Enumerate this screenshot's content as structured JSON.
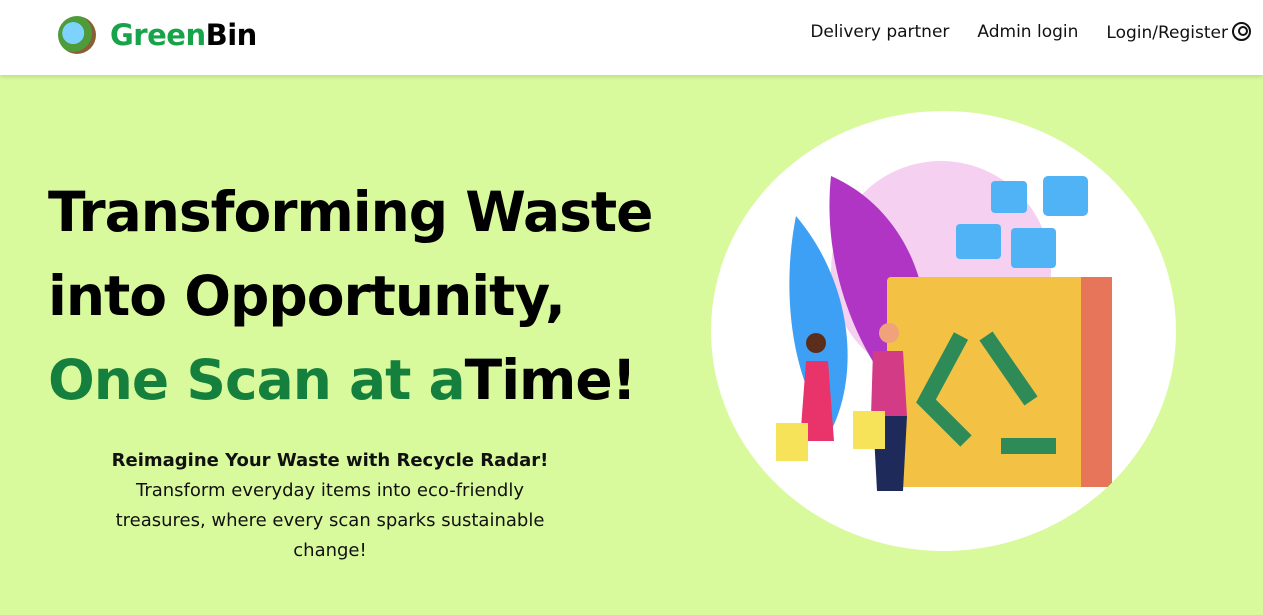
{
  "brand": {
    "part1": "Green",
    "part2": "Bin"
  },
  "nav": {
    "delivery": "Delivery partner",
    "admin": "Admin login",
    "login": "Login/Register"
  },
  "hero": {
    "line1": "Transforming Waste",
    "line2": "into Opportunity,",
    "line3_green": "One Scan at a",
    "line3_black": "Time!",
    "subtitle": "Reimagine Your Waste with Recycle Radar!",
    "body": "Transform everyday items into eco-friendly treasures, where every scan sparks sustainable change!"
  },
  "colors": {
    "brand_green": "#16a34a",
    "heading_green": "#15803d",
    "background": "#d9f99d"
  }
}
